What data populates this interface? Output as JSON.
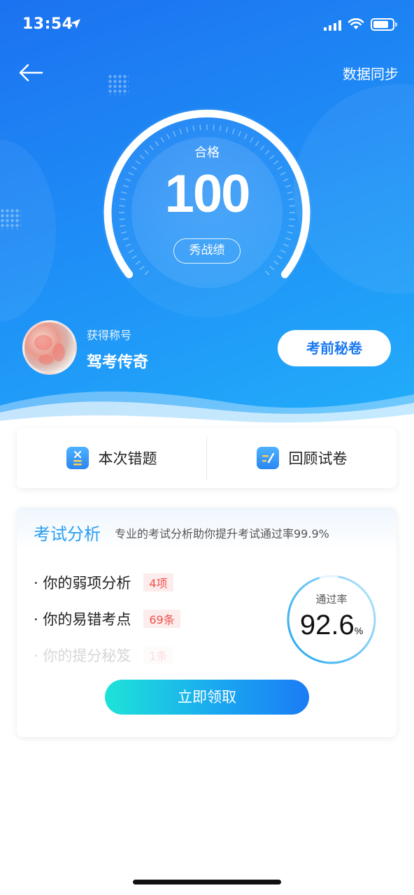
{
  "status_bar": {
    "time": "13:54"
  },
  "header": {
    "sync_label": "数据同步"
  },
  "result": {
    "pass_label": "合格",
    "score": "100",
    "show_label": "秀战绩"
  },
  "profile": {
    "title_label": "获得称号",
    "title_value": "驾考传奇",
    "secret_button": "考前秘卷"
  },
  "actions": {
    "wrong_label": "本次错题",
    "review_label": "回顾试卷"
  },
  "analysis": {
    "title": "考试分析",
    "subtitle": "专业的考试分析助你提升考试通过率99.9%",
    "items": [
      {
        "label": "· 你的弱项分析",
        "tag": "4项"
      },
      {
        "label": "· 你的易错考点",
        "tag": "69条"
      },
      {
        "label": "· 你的提分秘笈",
        "tag": "1条"
      }
    ],
    "rate_label": "通过率",
    "rate_value": "92.6",
    "rate_unit": "%",
    "claim_button": "立即领取"
  },
  "colors": {
    "primary": "#1c7cf4",
    "accent_text": "#2a9ef0",
    "tag_red": "#f0504c"
  },
  "icons": {
    "back": "arrow-left-icon",
    "location": "location-arrow-icon",
    "wrong": "wrong-questions-icon",
    "review": "review-paper-icon"
  }
}
